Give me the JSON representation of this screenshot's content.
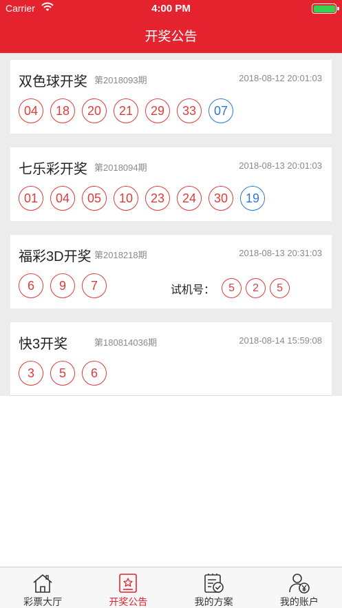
{
  "status_bar": {
    "carrier": "Carrier",
    "time": "4:00 PM"
  },
  "nav": {
    "title": "开奖公告"
  },
  "lotteries": [
    {
      "name": "双色球开奖",
      "issue": "第2018093期",
      "date": "2018-08-12 20:01:03",
      "red_balls": [
        "04",
        "18",
        "20",
        "21",
        "29",
        "33"
      ],
      "blue_balls": [
        "07"
      ]
    },
    {
      "name": "七乐彩开奖",
      "issue": "第2018094期",
      "date": "2018-08-13 20:01:03",
      "red_balls": [
        "01",
        "04",
        "05",
        "10",
        "23",
        "24",
        "30"
      ],
      "blue_balls": [
        "19"
      ]
    },
    {
      "name": "福彩3D开奖",
      "issue": "第2018218期",
      "date": "2018-08-13 20:31:03",
      "red_balls": [
        "6",
        "9",
        "7"
      ],
      "trial_label": "试机号：",
      "trial_balls": [
        "5",
        "2",
        "5"
      ]
    },
    {
      "name": "快3开奖",
      "issue": "第180814036期",
      "date": "2018-08-14 15:59:08",
      "red_balls": [
        "3",
        "5",
        "6"
      ]
    }
  ],
  "tabbar": {
    "items": [
      {
        "label": "彩票大厅",
        "icon": "home-icon"
      },
      {
        "label": "开奖公告",
        "icon": "announcement-icon",
        "active": true
      },
      {
        "label": "我的方案",
        "icon": "plan-icon"
      },
      {
        "label": "我的账户",
        "icon": "account-icon"
      }
    ]
  },
  "colors": {
    "brand": "#e5232f",
    "red_ball": "#e03a3a",
    "blue_ball": "#2b78d6",
    "battery": "#35d14f"
  }
}
